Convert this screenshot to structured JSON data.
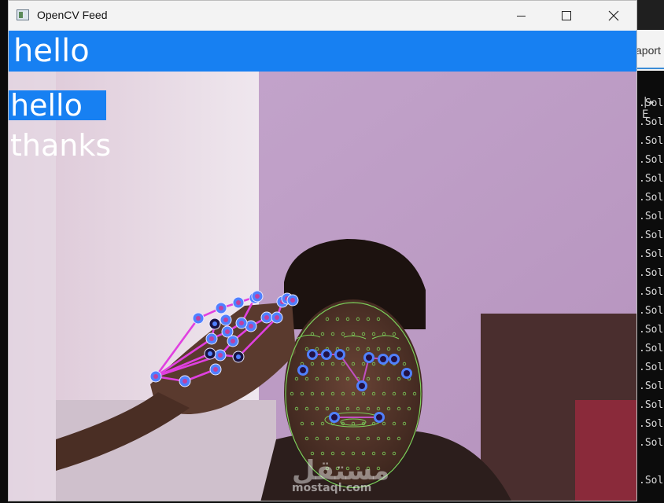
{
  "window": {
    "title": "OpenCV Feed"
  },
  "feed": {
    "header_text": "hello",
    "predictions": [
      "hello",
      "thanks"
    ],
    "watermark_logo": "مستقل",
    "watermark_url": "mostaql.com"
  },
  "background_terminal": {
    "tab_label": "aport",
    "head": "|▸ E",
    "lines": [
      ".Sol",
      ".Sol",
      ".Sol",
      ".Sol",
      ".Sol",
      ".Sol",
      ".Sol",
      ".Sol",
      ".Sol",
      ".Sol",
      ".Sol",
      ".Sol",
      ".Sol",
      ".Sol",
      ".Sol",
      ".Sol",
      ".Sol",
      ".Sol",
      ".Sol",
      "",
      ".Sol"
    ]
  },
  "colors": {
    "accent_blue": "#1780f2",
    "hand_connection": "#e040e0",
    "hand_landmark": "#5080ff",
    "face_mesh": "#7ccf5a"
  }
}
